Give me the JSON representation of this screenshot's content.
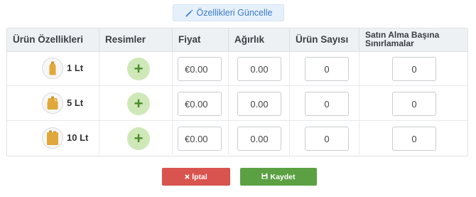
{
  "toolbar": {
    "update_label": "Özellikleri Güncelle",
    "update_icon": "pencil-icon"
  },
  "table": {
    "headers": {
      "features": "Ürün  Özellikleri",
      "images": "Resimler",
      "price": "Fiyat",
      "weight": "Ağırlık",
      "quantity": "Ürün Sayısı",
      "limit": "Satın Alma Başına Sınırlamalar"
    },
    "rows": [
      {
        "label": "1 Lt",
        "icon": "small-bottle-icon",
        "add_icon": "plus-icon",
        "price": "€0.00",
        "weight": "0.00",
        "quantity": "0",
        "limit": "0"
      },
      {
        "label": "5 Lt",
        "icon": "medium-jug-icon",
        "add_icon": "plus-icon",
        "price": "€0.00",
        "weight": "0.00",
        "quantity": "0",
        "limit": "0"
      },
      {
        "label": "10 Lt",
        "icon": "large-jerrycan-icon",
        "add_icon": "plus-icon",
        "price": "€0.00",
        "weight": "0.00",
        "quantity": "0",
        "limit": "0"
      }
    ]
  },
  "actions": {
    "cancel_label": "İptal",
    "cancel_icon": "times-icon",
    "save_label": "Kaydet",
    "save_icon": "floppy-disk-icon"
  },
  "colors": {
    "cancel": "#d9534f",
    "save": "#5ba043",
    "add": "#cfe8b8",
    "header_bg": "#eef1f3",
    "link": "#3a7bc8"
  }
}
